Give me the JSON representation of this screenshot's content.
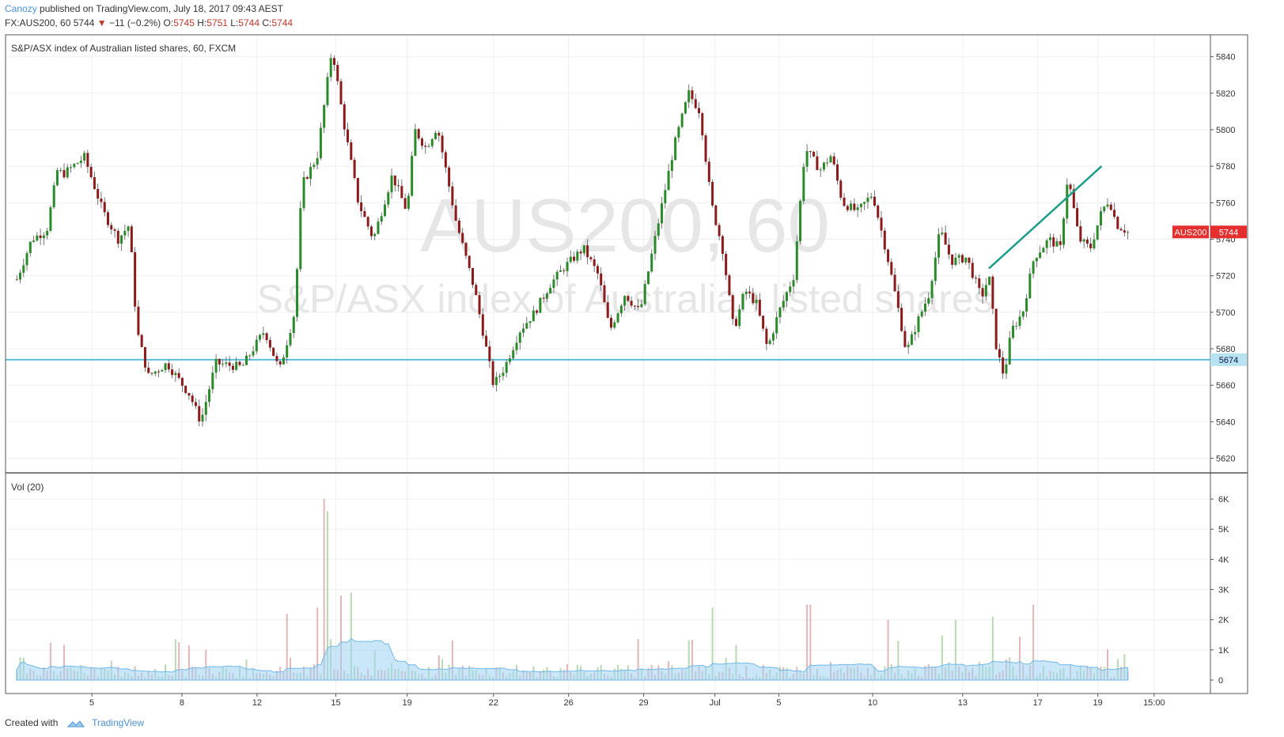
{
  "header": {
    "author": "Canozy",
    "published_text": "published on TradingView.com, July 18, 2017 09:43 AEST",
    "symbol_line": "FX:AUS200, 60",
    "last": "5744",
    "change": "−11 (−0.2%)",
    "o_label": "O:",
    "o_value": "5745",
    "h_label": "H:",
    "h_value": "5751",
    "l_label": "L:",
    "l_value": "5744",
    "c_label": "C:",
    "c_value": "5744"
  },
  "footer": {
    "created_with": "Created with",
    "brand": "TradingView"
  },
  "colors": {
    "up": "#2a8a2a",
    "down": "#8b1a1a",
    "hline": "#5bc0de",
    "trend": "#1a9e88",
    "badge": "#e52e2e",
    "vol_ma": "#9fd3f5"
  },
  "chart_data": {
    "type": "candlestick",
    "title": "S&P/ASX index of Australian listed shares, 60, FXCM",
    "watermark_symbol": "AUS200, 60",
    "watermark_desc": "S&P/ASX index of Australian listed shares",
    "price_ticks": [
      "5840",
      "5820",
      "5800",
      "5780",
      "5760",
      "5740",
      "5720",
      "5700",
      "5680",
      "5660",
      "5640",
      "5620"
    ],
    "price_range": [
      5612,
      5852
    ],
    "x_labels": [
      "5",
      "8",
      "12",
      "15",
      "19",
      "22",
      "26",
      "29",
      "Jul",
      "5",
      "10",
      "13",
      "17",
      "19",
      "15:00"
    ],
    "price_keypoints": [
      {
        "t": 0.0,
        "p": 5718
      },
      {
        "t": 0.2,
        "p": 5740
      },
      {
        "t": 0.4,
        "p": 5745
      },
      {
        "t": 0.55,
        "p": 5780
      },
      {
        "t": 0.6,
        "p": 5775
      },
      {
        "t": 0.9,
        "p": 5785
      },
      {
        "t": 1.15,
        "p": 5755
      },
      {
        "t": 1.35,
        "p": 5740
      },
      {
        "t": 1.5,
        "p": 5748
      },
      {
        "t": 1.6,
        "p": 5690
      },
      {
        "t": 1.75,
        "p": 5665
      },
      {
        "t": 2.0,
        "p": 5672
      },
      {
        "t": 2.3,
        "p": 5655
      },
      {
        "t": 2.45,
        "p": 5640
      },
      {
        "t": 2.65,
        "p": 5672
      },
      {
        "t": 3.0,
        "p": 5670
      },
      {
        "t": 3.3,
        "p": 5690
      },
      {
        "t": 3.5,
        "p": 5668
      },
      {
        "t": 3.7,
        "p": 5700
      },
      {
        "t": 3.8,
        "p": 5770
      },
      {
        "t": 4.0,
        "p": 5785
      },
      {
        "t": 4.1,
        "p": 5815
      },
      {
        "t": 4.2,
        "p": 5845
      },
      {
        "t": 4.35,
        "p": 5805
      },
      {
        "t": 4.55,
        "p": 5760
      },
      {
        "t": 4.75,
        "p": 5740
      },
      {
        "t": 5.0,
        "p": 5775
      },
      {
        "t": 5.2,
        "p": 5755
      },
      {
        "t": 5.3,
        "p": 5800
      },
      {
        "t": 5.45,
        "p": 5790
      },
      {
        "t": 5.6,
        "p": 5802
      },
      {
        "t": 5.85,
        "p": 5750
      },
      {
        "t": 6.1,
        "p": 5712
      },
      {
        "t": 6.35,
        "p": 5660
      },
      {
        "t": 6.5,
        "p": 5670
      },
      {
        "t": 6.7,
        "p": 5690
      },
      {
        "t": 6.9,
        "p": 5700
      },
      {
        "t": 7.1,
        "p": 5715
      },
      {
        "t": 7.3,
        "p": 5725
      },
      {
        "t": 7.55,
        "p": 5735
      },
      {
        "t": 7.75,
        "p": 5720
      },
      {
        "t": 7.9,
        "p": 5690
      },
      {
        "t": 8.1,
        "p": 5710
      },
      {
        "t": 8.3,
        "p": 5700
      },
      {
        "t": 8.5,
        "p": 5740
      },
      {
        "t": 8.75,
        "p": 5790
      },
      {
        "t": 8.95,
        "p": 5820
      },
      {
        "t": 9.1,
        "p": 5810
      },
      {
        "t": 9.25,
        "p": 5760
      },
      {
        "t": 9.4,
        "p": 5735
      },
      {
        "t": 9.55,
        "p": 5690
      },
      {
        "t": 9.7,
        "p": 5712
      },
      {
        "t": 9.85,
        "p": 5705
      },
      {
        "t": 10.0,
        "p": 5680
      },
      {
        "t": 10.15,
        "p": 5700
      },
      {
        "t": 10.35,
        "p": 5720
      },
      {
        "t": 10.5,
        "p": 5790
      },
      {
        "t": 10.7,
        "p": 5778
      },
      {
        "t": 10.85,
        "p": 5786
      },
      {
        "t": 11.0,
        "p": 5760
      },
      {
        "t": 11.2,
        "p": 5755
      },
      {
        "t": 11.4,
        "p": 5765
      },
      {
        "t": 11.6,
        "p": 5730
      },
      {
        "t": 11.75,
        "p": 5700
      },
      {
        "t": 11.85,
        "p": 5678
      },
      {
        "t": 12.0,
        "p": 5695
      },
      {
        "t": 12.15,
        "p": 5710
      },
      {
        "t": 12.3,
        "p": 5745
      },
      {
        "t": 12.45,
        "p": 5728
      },
      {
        "t": 12.65,
        "p": 5730
      },
      {
        "t": 12.85,
        "p": 5708
      },
      {
        "t": 12.95,
        "p": 5720
      },
      {
        "t": 13.05,
        "p": 5680
      },
      {
        "t": 13.15,
        "p": 5665
      },
      {
        "t": 13.25,
        "p": 5690
      },
      {
        "t": 13.4,
        "p": 5700
      },
      {
        "t": 13.55,
        "p": 5730
      },
      {
        "t": 13.75,
        "p": 5740
      },
      {
        "t": 13.9,
        "p": 5735
      },
      {
        "t": 14.0,
        "p": 5775
      },
      {
        "t": 14.15,
        "p": 5740
      },
      {
        "t": 14.3,
        "p": 5735
      },
      {
        "t": 14.45,
        "p": 5755
      },
      {
        "t": 14.55,
        "p": 5762
      },
      {
        "t": 14.65,
        "p": 5748
      },
      {
        "t": 14.8,
        "p": 5744
      }
    ],
    "hline_price": 5674,
    "hline_label": "5674",
    "trendline": {
      "t0": 12.95,
      "p0": 5724,
      "t1": 14.45,
      "p1": 5780
    },
    "last_badge_symbol": "AUS200",
    "last_badge_value": "5744",
    "volume": {
      "label": "Vol (20)",
      "ticks": [
        "6K",
        "5K",
        "4K",
        "3K",
        "2K",
        "1K",
        "0"
      ],
      "max": 6500,
      "spikes": [
        {
          "t": 4.1,
          "v": 6000
        },
        {
          "t": 4.13,
          "v": 5600
        },
        {
          "t": 4.3,
          "v": 2800
        },
        {
          "t": 4.45,
          "v": 2900
        },
        {
          "t": 4.0,
          "v": 2400
        },
        {
          "t": 3.6,
          "v": 2200
        },
        {
          "t": 9.25,
          "v": 2400
        },
        {
          "t": 10.55,
          "v": 2500
        },
        {
          "t": 13.55,
          "v": 2500
        },
        {
          "t": 12.5,
          "v": 2000
        },
        {
          "t": 13.0,
          "v": 2100
        },
        {
          "t": 11.6,
          "v": 2000
        }
      ]
    }
  }
}
